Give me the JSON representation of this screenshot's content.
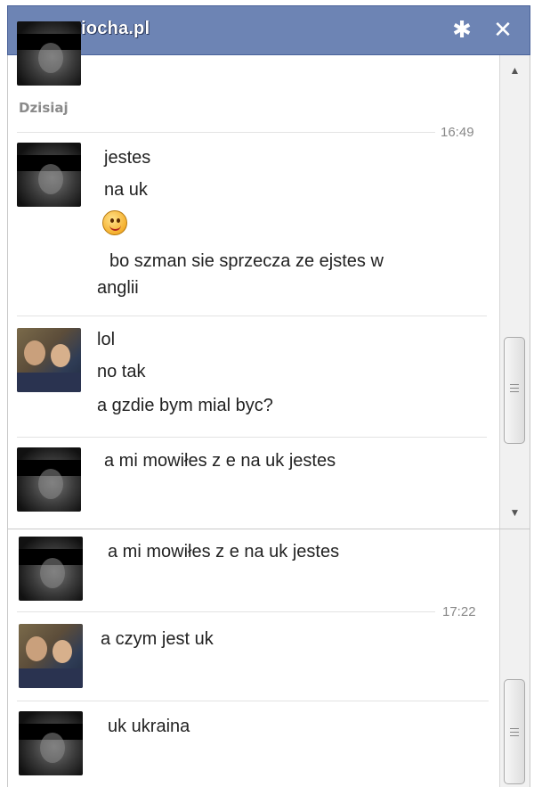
{
  "watermark": "www.wiocha.pl",
  "header": {
    "settings_icon": "gear-icon",
    "close_icon": "close-icon",
    "close_glyph": "✕",
    "settings_glyph": "✱"
  },
  "day_label": "Dzisiaj",
  "pane1": {
    "time": "16:49",
    "groups": [
      {
        "lines": [
          "jestes",
          "na uk",
          "",
          "bo szman sie sprzecza ze ejstes  w",
          "anglii"
        ]
      },
      {
        "lines": [
          "lol",
          "no tak",
          "a gzdie bym mial byc?"
        ]
      },
      {
        "lines": [
          "a mi mowiłes z e na uk jestes"
        ]
      }
    ]
  },
  "pane2": {
    "time": "17:22",
    "groups": [
      {
        "lines": [
          "a mi mowiłes z e na uk jestes"
        ]
      },
      {
        "lines": [
          "a czym jest uk"
        ]
      },
      {
        "lines": [
          "uk ukraina"
        ]
      }
    ]
  },
  "scroll": {
    "up": "▲",
    "down": "▼"
  }
}
